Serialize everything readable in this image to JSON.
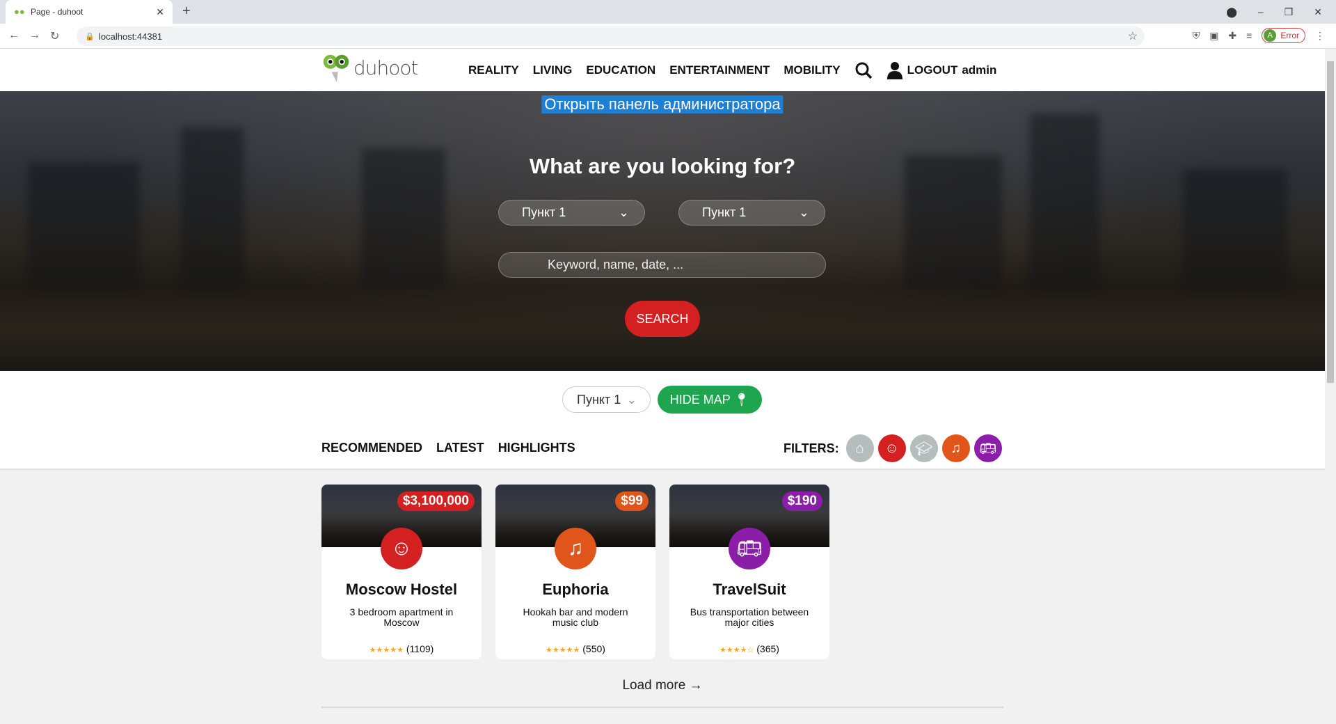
{
  "browser": {
    "tab_title": "Page - duhoot",
    "url": "localhost:44381",
    "profile_status": "Error",
    "profile_initial": "A"
  },
  "header": {
    "logo_text": "duhoot",
    "nav": [
      "REALITY",
      "LIVING",
      "EDUCATION",
      "ENTERTAINMENT",
      "MOBILITY"
    ],
    "logout_label": "LOGOUT",
    "username": "admin"
  },
  "hero": {
    "admin_link": "Открыть панель администратора",
    "title": "What are you looking for?",
    "select1": "Пункт 1",
    "select2": "Пункт 1",
    "search_placeholder": "Keyword, name, date, ...",
    "search_label": "SEARCH"
  },
  "listing": {
    "dropdown": "Пункт 1",
    "hide_map": "HIDE MAP",
    "tabs": [
      "RECOMMENDED",
      "LATEST",
      "HIGHLIGHTS"
    ],
    "filters_label": "FILTERS:",
    "filter_colors": [
      "#b5bdbd",
      "#d42020",
      "#b5bdbd",
      "#e0561a",
      "#8a1ea8"
    ]
  },
  "cards": [
    {
      "price": "$3,100,000",
      "title": "Moscow Hostel",
      "desc": "3 bedroom apartment in Moscow",
      "stars": "★★★★★",
      "rating": 5,
      "reviews": "(1109)",
      "color": "#d42020",
      "icon": "hostel-icon"
    },
    {
      "price": "$99",
      "title": "Euphoria",
      "desc": "Hookah bar and modern music club",
      "stars": "★★★★★",
      "rating": 5,
      "reviews": "(550)",
      "color": "#e0561a",
      "icon": "music-icon"
    },
    {
      "price": "$190",
      "title": "TravelSuit",
      "desc": "Bus transportation between major cities",
      "stars": "★★★★☆",
      "rating": 4,
      "reviews": "(365)",
      "color": "#8a1ea8",
      "icon": "bus-icon"
    }
  ],
  "load_more": "Load more →"
}
